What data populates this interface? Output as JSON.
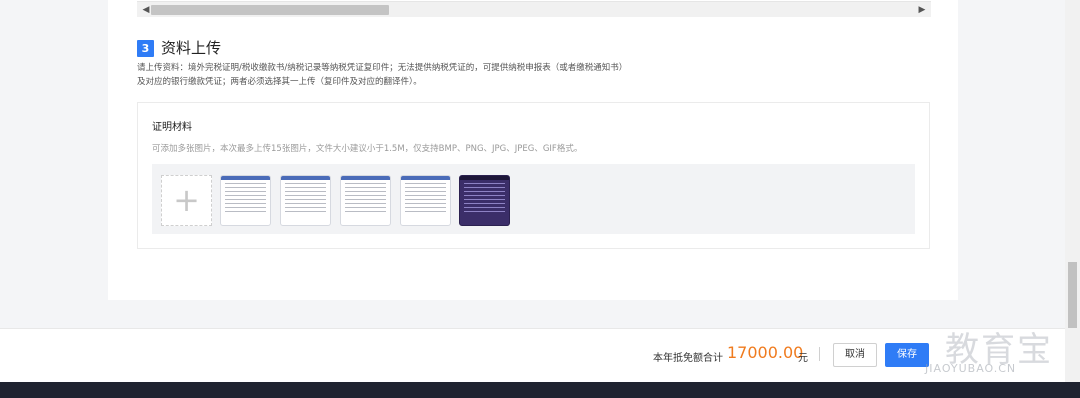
{
  "scrollbar": {
    "left_arrow": "◀",
    "right_arrow": "▶"
  },
  "section": {
    "step_number": "3",
    "title": "资料上传",
    "instruction_line1": "请上传资料：境外完税证明/税收缴款书/纳税记录等纳税凭证复印件；无法提供纳税凭证的，可提供纳税申报表（或者缴税通知书）",
    "instruction_line2": "及对应的银行缴款凭证；两者必须选择其一上传（复印件及对应的翻译件）。"
  },
  "upload": {
    "title": "证明材料",
    "hint": "可添加多张图片，本次最多上传15张图片，文件大小建议小于1.5M，仅支持BMP、PNG、JPG、JPEG、GIF格式。",
    "add_symbol": "+",
    "thumbnails": [
      {
        "name": "uploaded-image-1",
        "style": "light"
      },
      {
        "name": "uploaded-image-2",
        "style": "light"
      },
      {
        "name": "uploaded-image-3",
        "style": "light"
      },
      {
        "name": "uploaded-image-4",
        "style": "light"
      },
      {
        "name": "uploaded-image-5",
        "style": "dark"
      }
    ]
  },
  "footer": {
    "total_label": "本年抵免额合计",
    "total_value": "17000.00",
    "total_unit": "元",
    "cancel_label": "取消",
    "save_label": "保存"
  },
  "watermark": {
    "cn": "教育宝",
    "en": "JIAOYUBAO.CN"
  },
  "colors": {
    "accent": "#2f7cf6",
    "amount": "#f07b1e"
  }
}
